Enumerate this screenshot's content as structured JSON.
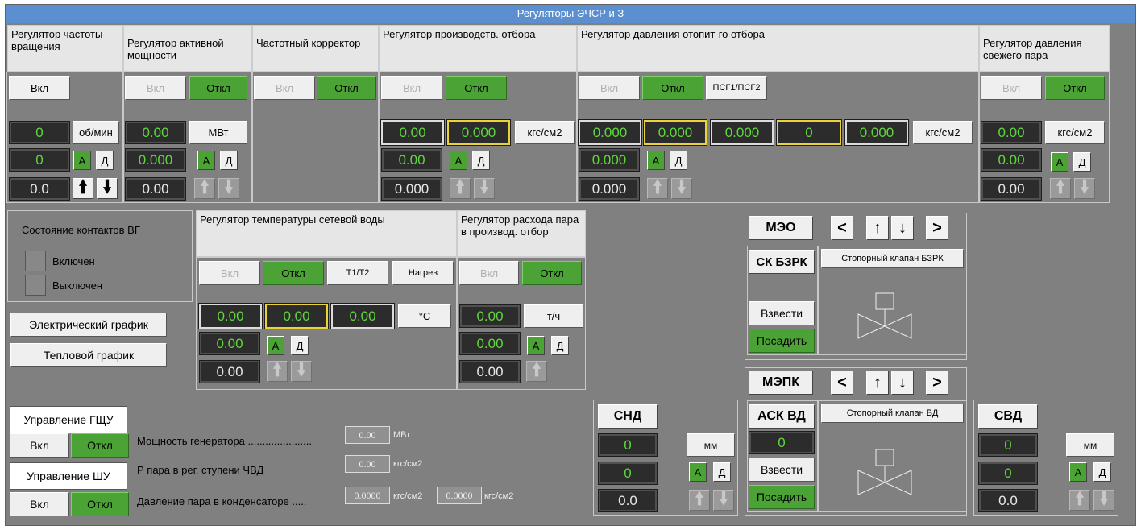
{
  "title": "Регуляторы ЭЧСР и З",
  "labels": {
    "on": "Вкл",
    "off": "Откл",
    "A": "А",
    "D": "Д",
    "rpm": "об/мин",
    "mw": "МВт",
    "kgs": "кгс/см2",
    "degc": "°С",
    "th": "т/ч",
    "mm": "мм"
  },
  "reg1": {
    "title": "Регулятор частоты вращения",
    "v1": "0",
    "v2": "0",
    "v3": "0.0"
  },
  "reg2": {
    "title": "Регулятор активной мощности",
    "v1": "0.00",
    "v2": "0.000",
    "v3": "0.00"
  },
  "reg3": {
    "title": "Частотный корректор"
  },
  "reg4": {
    "title": "Регулятор производств. отбора",
    "v1": "0.00",
    "v1b": "0.000",
    "v2": "0.00",
    "v3": "0.000"
  },
  "reg5": {
    "title": "Регулятор давления отопит-го отбора",
    "psg": "ПСГ1/ПСГ2",
    "v1": "0.000",
    "v1b": "0.000",
    "v1c": "0.000",
    "v1d": "0",
    "v1e": "0.000",
    "v2": "0.000",
    "v3": "0.000"
  },
  "reg6": {
    "title": "Регулятор давления свежего пара",
    "v1": "0.00",
    "v2": "0.00",
    "v3": "0.00"
  },
  "contacts": {
    "title": "Состояние контактов ВГ",
    "on": "Включен",
    "off": "Выключен"
  },
  "buttons": {
    "elec": "Электрический график",
    "heat": "Тепловой график"
  },
  "reg7": {
    "title": "Регулятор температуры сетевой воды",
    "t": "Т1/Т2",
    "heat": "Нагрев",
    "v1": "0.00",
    "v1b": "0.00",
    "v1c": "0.00",
    "v2": "0.00",
    "v3": "0.00"
  },
  "reg8": {
    "title": "Регулятор расхода пара в производ. отбор",
    "v1": "0.00",
    "v2": "0.00",
    "v3": "0.00"
  },
  "mgmt": {
    "gshu": "Управление ГЩУ",
    "shu": "Управление ШУ"
  },
  "params": {
    "power_label": "Мощность генератора ......................",
    "power_value": "0.00",
    "power_unit": "МВт",
    "p_label": "Р пара в рег. ступени ЧВД",
    "p_value": "0.00",
    "p_unit": "кгс/см2",
    "cond_label": "Давление пара в конденсаторе .....",
    "cond_v1": "0.0000",
    "cond_u1": "кгс/см2",
    "cond_v2": "0.0000",
    "cond_u2": "кгс/см2"
  },
  "meo": {
    "label": "МЭО",
    "left": "<",
    "up": "↑",
    "down": "↓",
    "right": ">"
  },
  "mepk": {
    "label": "МЭПК",
    "left": "<",
    "up": "↑",
    "down": "↓",
    "right": ">"
  },
  "bzrk": {
    "label": "СК БЗРК",
    "valve": "Стопорный клапан БЗРК",
    "raise": "Взвести",
    "land": "Посадить"
  },
  "askvd": {
    "label": "АСК ВД",
    "value": "0",
    "valve": "Стопорный клапан ВД",
    "raise": "Взвести",
    "land": "Посадить"
  },
  "snd": {
    "label": "СНД",
    "v1": "0",
    "v2": "0",
    "v3": "0.0"
  },
  "svd": {
    "label": "СВД",
    "v1": "0",
    "v2": "0",
    "v3": "0.0"
  },
  "colors": {
    "title_bar": "#5b8fd0",
    "panel": "#808080",
    "value_green": "#5fd73c",
    "button_green": "#4ba335",
    "highlight_yellow": "#e8d43a"
  }
}
